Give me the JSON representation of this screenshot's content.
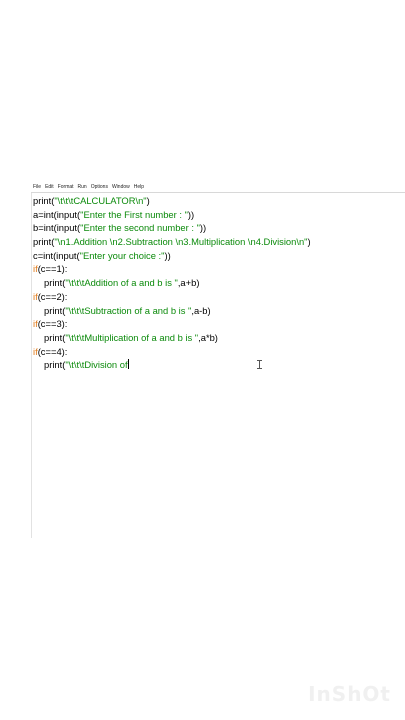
{
  "menu": {
    "items": [
      "File",
      "Edit",
      "Format",
      "Run",
      "Options",
      "Window",
      "Help"
    ]
  },
  "code": {
    "lines": [
      [
        {
          "t": "print(",
          "c": "black"
        },
        {
          "t": "\"\\t\\t\\tCALCULATOR\\n\"",
          "c": "green"
        },
        {
          "t": ")",
          "c": "black"
        }
      ],
      [
        {
          "t": "a=int(input(",
          "c": "black"
        },
        {
          "t": "\"Enter the First number : \"",
          "c": "green"
        },
        {
          "t": "))",
          "c": "black"
        }
      ],
      [
        {
          "t": "b=int(input(",
          "c": "black"
        },
        {
          "t": "\"Enter the second number : \"",
          "c": "green"
        },
        {
          "t": "))",
          "c": "black"
        }
      ],
      [
        {
          "t": "print(",
          "c": "black"
        },
        {
          "t": "\"\\n1.Addition \\n2.Subtraction \\n3.Multiplication \\n4.Division\\n\"",
          "c": "green"
        },
        {
          "t": ")",
          "c": "black"
        }
      ],
      [
        {
          "t": "c=int(input(",
          "c": "black"
        },
        {
          "t": "\"Enter your choice :\"",
          "c": "green"
        },
        {
          "t": "))",
          "c": "black"
        }
      ],
      [
        {
          "t": "if",
          "c": "orange"
        },
        {
          "t": "(c==1):",
          "c": "black"
        }
      ],
      [
        {
          "t": "INDENT",
          "c": "indent"
        },
        {
          "t": "print(",
          "c": "black"
        },
        {
          "t": "\"\\t\\t\\tAddition of a and b is \"",
          "c": "green"
        },
        {
          "t": ",a+b)",
          "c": "black"
        }
      ],
      [
        {
          "t": "if",
          "c": "orange"
        },
        {
          "t": "(c==2):",
          "c": "black"
        }
      ],
      [
        {
          "t": "INDENT",
          "c": "indent"
        },
        {
          "t": "print(",
          "c": "black"
        },
        {
          "t": "\"\\t\\t\\tSubtraction of a and b is \"",
          "c": "green"
        },
        {
          "t": ",a-b)",
          "c": "black"
        }
      ],
      [
        {
          "t": "if",
          "c": "orange"
        },
        {
          "t": "(c==3):",
          "c": "black"
        }
      ],
      [
        {
          "t": "INDENT",
          "c": "indent"
        },
        {
          "t": "print(",
          "c": "black"
        },
        {
          "t": "\"\\t\\t\\tMultiplication of a and b is \"",
          "c": "green"
        },
        {
          "t": ",a*b)",
          "c": "black"
        }
      ],
      [
        {
          "t": "if",
          "c": "orange"
        },
        {
          "t": "(c==4):",
          "c": "black"
        }
      ],
      [
        {
          "t": "INDENT",
          "c": "indent"
        },
        {
          "t": "print(",
          "c": "black"
        },
        {
          "t": "\"\\t\\t\\tDivision of",
          "c": "green"
        },
        {
          "t": "CARET",
          "c": "caret"
        }
      ]
    ]
  },
  "colors": {
    "keyword": "#e07a1a",
    "string": "#0b8a0b",
    "default": "#000000"
  },
  "watermark": {
    "text": "InShOt"
  }
}
